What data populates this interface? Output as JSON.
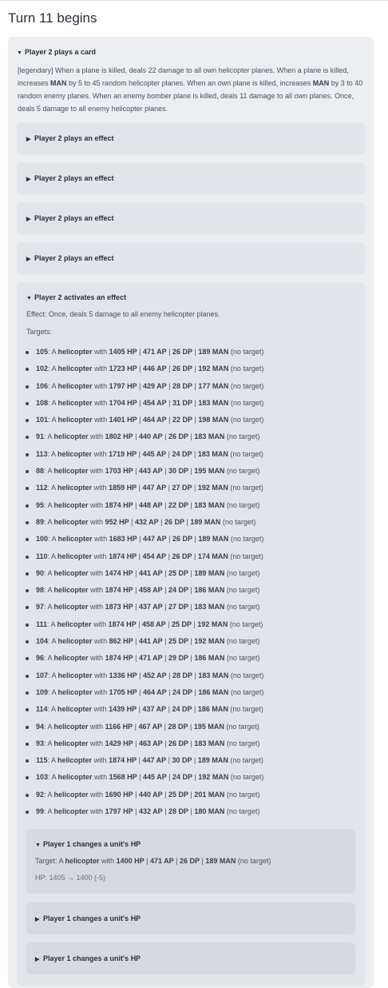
{
  "turn_title": "Turn 11 begins",
  "card": {
    "header": "Player 2 plays a card",
    "description_parts": [
      {
        "t": "[legendary] When a plane is killed, deals 22 damage to all own helicopter planes. When a plane is killed, increases ",
        "b": false
      },
      {
        "t": "MAN",
        "b": true
      },
      {
        "t": " by 5 to 45 random helicopter planes. When an own plane is killed, increases ",
        "b": false
      },
      {
        "t": "MAN",
        "b": true
      },
      {
        "t": " by 3 to 40 random enemy planes. When an enemy bomber plane is killed, deals 11 damage to all own planes. Once, deals 5 damage to all enemy helicopter planes.",
        "b": false
      }
    ]
  },
  "effects": [
    {
      "header": "Player 2 plays an effect"
    },
    {
      "header": "Player 2 plays an effect"
    },
    {
      "header": "Player 2 plays an effect"
    },
    {
      "header": "Player 2 plays an effect"
    }
  ],
  "activation": {
    "header": "Player 2 activates an effect",
    "effect_text": "Effect: Once, deals 5 damage to all enemy helicopter planes.",
    "targets_label": "Targets:",
    "targets": [
      {
        "id": "105",
        "hp": "1405 HP",
        "ap": "471 AP",
        "dp": "26 DP",
        "man": "189 MAN"
      },
      {
        "id": "102",
        "hp": "1723 HP",
        "ap": "446 AP",
        "dp": "26 DP",
        "man": "192 MAN"
      },
      {
        "id": "106",
        "hp": "1797 HP",
        "ap": "429 AP",
        "dp": "28 DP",
        "man": "177 MAN"
      },
      {
        "id": "108",
        "hp": "1704 HP",
        "ap": "454 AP",
        "dp": "31 DP",
        "man": "183 MAN"
      },
      {
        "id": "101",
        "hp": "1401 HP",
        "ap": "464 AP",
        "dp": "22 DP",
        "man": "198 MAN"
      },
      {
        "id": "91",
        "hp": "1802 HP",
        "ap": "440 AP",
        "dp": "26 DP",
        "man": "183 MAN"
      },
      {
        "id": "113",
        "hp": "1719 HP",
        "ap": "445 AP",
        "dp": "24 DP",
        "man": "183 MAN"
      },
      {
        "id": "88",
        "hp": "1703 HP",
        "ap": "443 AP",
        "dp": "30 DP",
        "man": "195 MAN"
      },
      {
        "id": "112",
        "hp": "1859 HP",
        "ap": "447 AP",
        "dp": "27 DP",
        "man": "192 MAN"
      },
      {
        "id": "95",
        "hp": "1874 HP",
        "ap": "448 AP",
        "dp": "22 DP",
        "man": "183 MAN"
      },
      {
        "id": "89",
        "hp": "952 HP",
        "ap": "432 AP",
        "dp": "26 DP",
        "man": "189 MAN"
      },
      {
        "id": "100",
        "hp": "1683 HP",
        "ap": "447 AP",
        "dp": "26 DP",
        "man": "189 MAN"
      },
      {
        "id": "110",
        "hp": "1874 HP",
        "ap": "454 AP",
        "dp": "26 DP",
        "man": "174 MAN"
      },
      {
        "id": "90",
        "hp": "1474 HP",
        "ap": "441 AP",
        "dp": "25 DP",
        "man": "189 MAN"
      },
      {
        "id": "98",
        "hp": "1874 HP",
        "ap": "458 AP",
        "dp": "24 DP",
        "man": "186 MAN"
      },
      {
        "id": "97",
        "hp": "1873 HP",
        "ap": "437 AP",
        "dp": "27 DP",
        "man": "183 MAN"
      },
      {
        "id": "111",
        "hp": "1874 HP",
        "ap": "458 AP",
        "dp": "25 DP",
        "man": "192 MAN"
      },
      {
        "id": "104",
        "hp": "862 HP",
        "ap": "441 AP",
        "dp": "25 DP",
        "man": "192 MAN"
      },
      {
        "id": "96",
        "hp": "1874 HP",
        "ap": "471 AP",
        "dp": "29 DP",
        "man": "186 MAN"
      },
      {
        "id": "107",
        "hp": "1336 HP",
        "ap": "452 AP",
        "dp": "28 DP",
        "man": "183 MAN"
      },
      {
        "id": "109",
        "hp": "1705 HP",
        "ap": "464 AP",
        "dp": "24 DP",
        "man": "186 MAN"
      },
      {
        "id": "114",
        "hp": "1439 HP",
        "ap": "437 AP",
        "dp": "24 DP",
        "man": "186 MAN"
      },
      {
        "id": "94",
        "hp": "1166 HP",
        "ap": "467 AP",
        "dp": "28 DP",
        "man": "195 MAN"
      },
      {
        "id": "93",
        "hp": "1429 HP",
        "ap": "463 AP",
        "dp": "26 DP",
        "man": "183 MAN"
      },
      {
        "id": "115",
        "hp": "1874 HP",
        "ap": "447 AP",
        "dp": "30 DP",
        "man": "189 MAN"
      },
      {
        "id": "103",
        "hp": "1568 HP",
        "ap": "445 AP",
        "dp": "24 DP",
        "man": "192 MAN"
      },
      {
        "id": "92",
        "hp": "1690 HP",
        "ap": "440 AP",
        "dp": "25 DP",
        "man": "201 MAN"
      },
      {
        "id": "99",
        "hp": "1797 HP",
        "ap": "432 AP",
        "dp": "28 DP",
        "man": "180 MAN"
      }
    ],
    "target_prefix": ": A ",
    "unit_type": "helicopter",
    "with_word": " with ",
    "sep": " | ",
    "no_target": " (no target)",
    "changes": [
      {
        "header": "Player 1 changes a unit's HP",
        "expanded": true,
        "target_label": "Target: A ",
        "unit_type": "helicopter",
        "with_word": " with ",
        "hp": "1400 HP",
        "ap": "471 AP",
        "dp": "26 DP",
        "man": "189 MAN",
        "no_target": " (no target)",
        "hp_change": "HP: 1405 → 1400 (-5)"
      },
      {
        "header": "Player 1 changes a unit's HP",
        "expanded": false
      },
      {
        "header": "Player 1 changes a unit's HP",
        "expanded": false
      }
    ]
  }
}
